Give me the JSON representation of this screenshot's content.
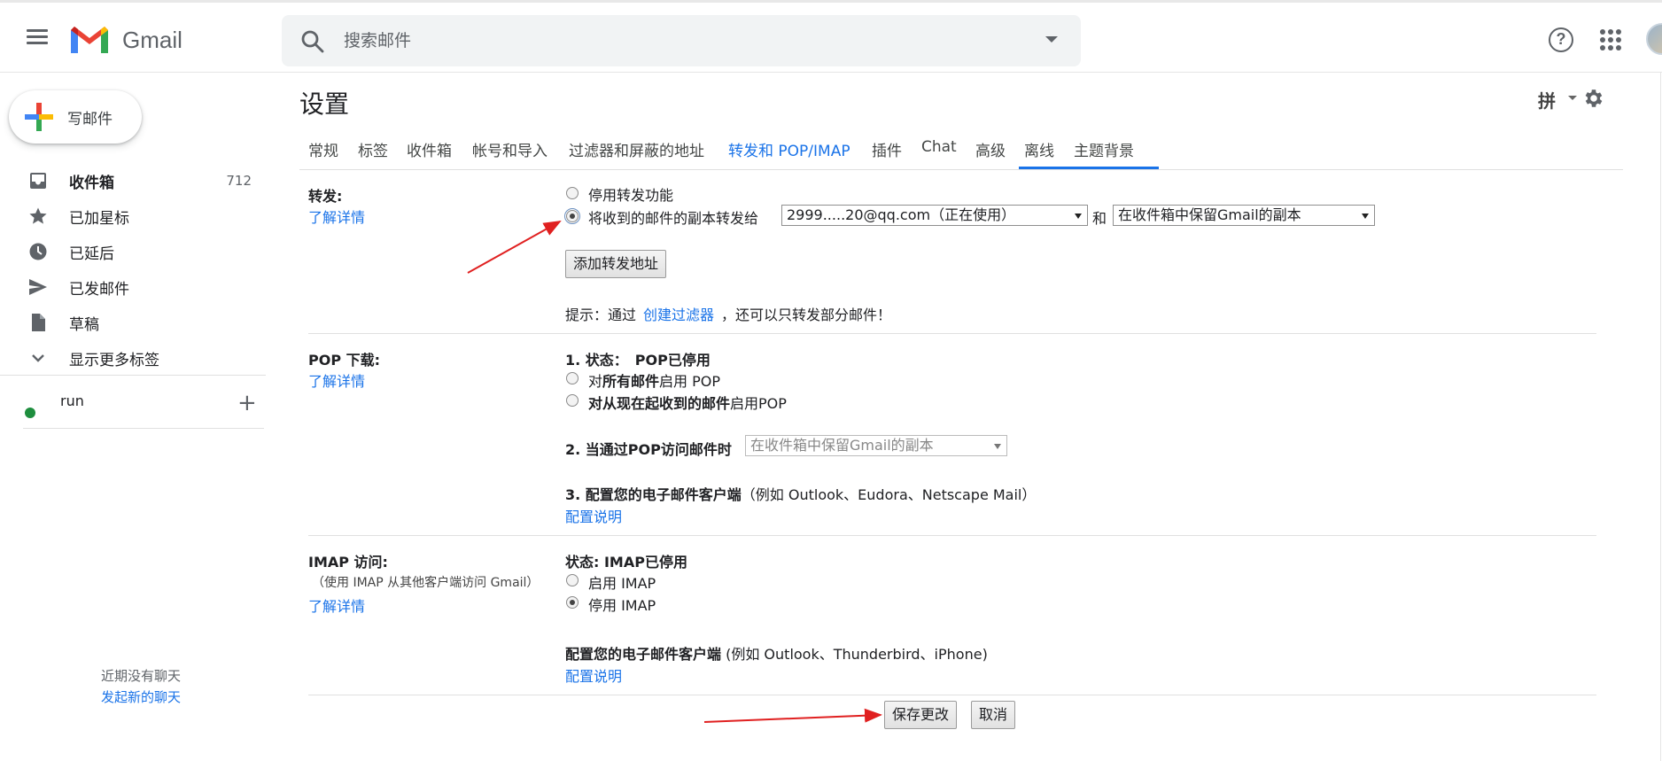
{
  "header": {
    "app_name": "Gmail",
    "search_placeholder": "搜索邮件"
  },
  "sidebar": {
    "compose_label": "写邮件",
    "items": [
      {
        "label": "收件箱",
        "count": "712",
        "icon": "inbox-icon"
      },
      {
        "label": "已加星标",
        "icon": "star-icon"
      },
      {
        "label": "已延后",
        "icon": "clock-icon"
      },
      {
        "label": "已发邮件",
        "icon": "send-icon"
      },
      {
        "label": "草稿",
        "icon": "draft-icon"
      },
      {
        "label": "显示更多标签",
        "icon": "chevron-down-icon"
      }
    ],
    "chat_user": "run",
    "no_chat_text": "近期没有聊天",
    "start_chat_link": "发起新的聊天"
  },
  "settings": {
    "title": "设置",
    "input_tool": "拼",
    "tabs": [
      "常规",
      "标签",
      "收件箱",
      "帐号和导入",
      "过滤器和屏蔽的地址",
      "转发和 POP/IMAP",
      "插件",
      "Chat",
      "高级",
      "离线",
      "主题背景"
    ],
    "active_tab": "转发和 POP/IMAP",
    "forwarding": {
      "label": "转发:",
      "learn_more": "了解详情",
      "option_disable": "停用转发功能",
      "option_forward": "将收到的邮件的副本转发给",
      "forward_address": "2999.....20@qq.com（正在使用）",
      "and": "和",
      "keep_option": "在收件箱中保留Gmail的副本",
      "add_button": "添加转发地址",
      "tip_prefix": "提示：通过",
      "tip_link": "创建过滤器",
      "tip_suffix": "，还可以只转发部分邮件！"
    },
    "pop": {
      "label": "POP 下载:",
      "learn_more": "了解详情",
      "status_prefix": "1. 状态：",
      "status_value": "POP已停用",
      "option_all_pre": "对",
      "option_all_bold": "所有邮件",
      "option_all_post": "启用 POP",
      "option_now_bold": "对从现在起收到的邮件",
      "option_now_post": "启用POP",
      "when_access": "2. 当通过POP访问邮件时",
      "when_access_select": "在收件箱中保留Gmail的副本",
      "configure_bold": "3. 配置您的电子邮件客户端",
      "configure_note": "（例如 Outlook、Eudora、Netscape Mail）",
      "config_link": "配置说明"
    },
    "imap": {
      "label": "IMAP 访问:",
      "note": "（使用 IMAP 从其他客户端访问 Gmail）",
      "learn_more": "了解详情",
      "status": "状态: IMAP已停用",
      "enable": "启用 IMAP",
      "disable": "停用 IMAP",
      "configure_bold": "配置您的电子邮件客户端",
      "configure_note": " (例如 Outlook、Thunderbird、iPhone)",
      "config_link": "配置说明"
    },
    "save_button": "保存更改",
    "cancel_button": "取消"
  },
  "colors": {
    "accent": "#1a73e8",
    "annotation_arrow": "#e02020"
  }
}
